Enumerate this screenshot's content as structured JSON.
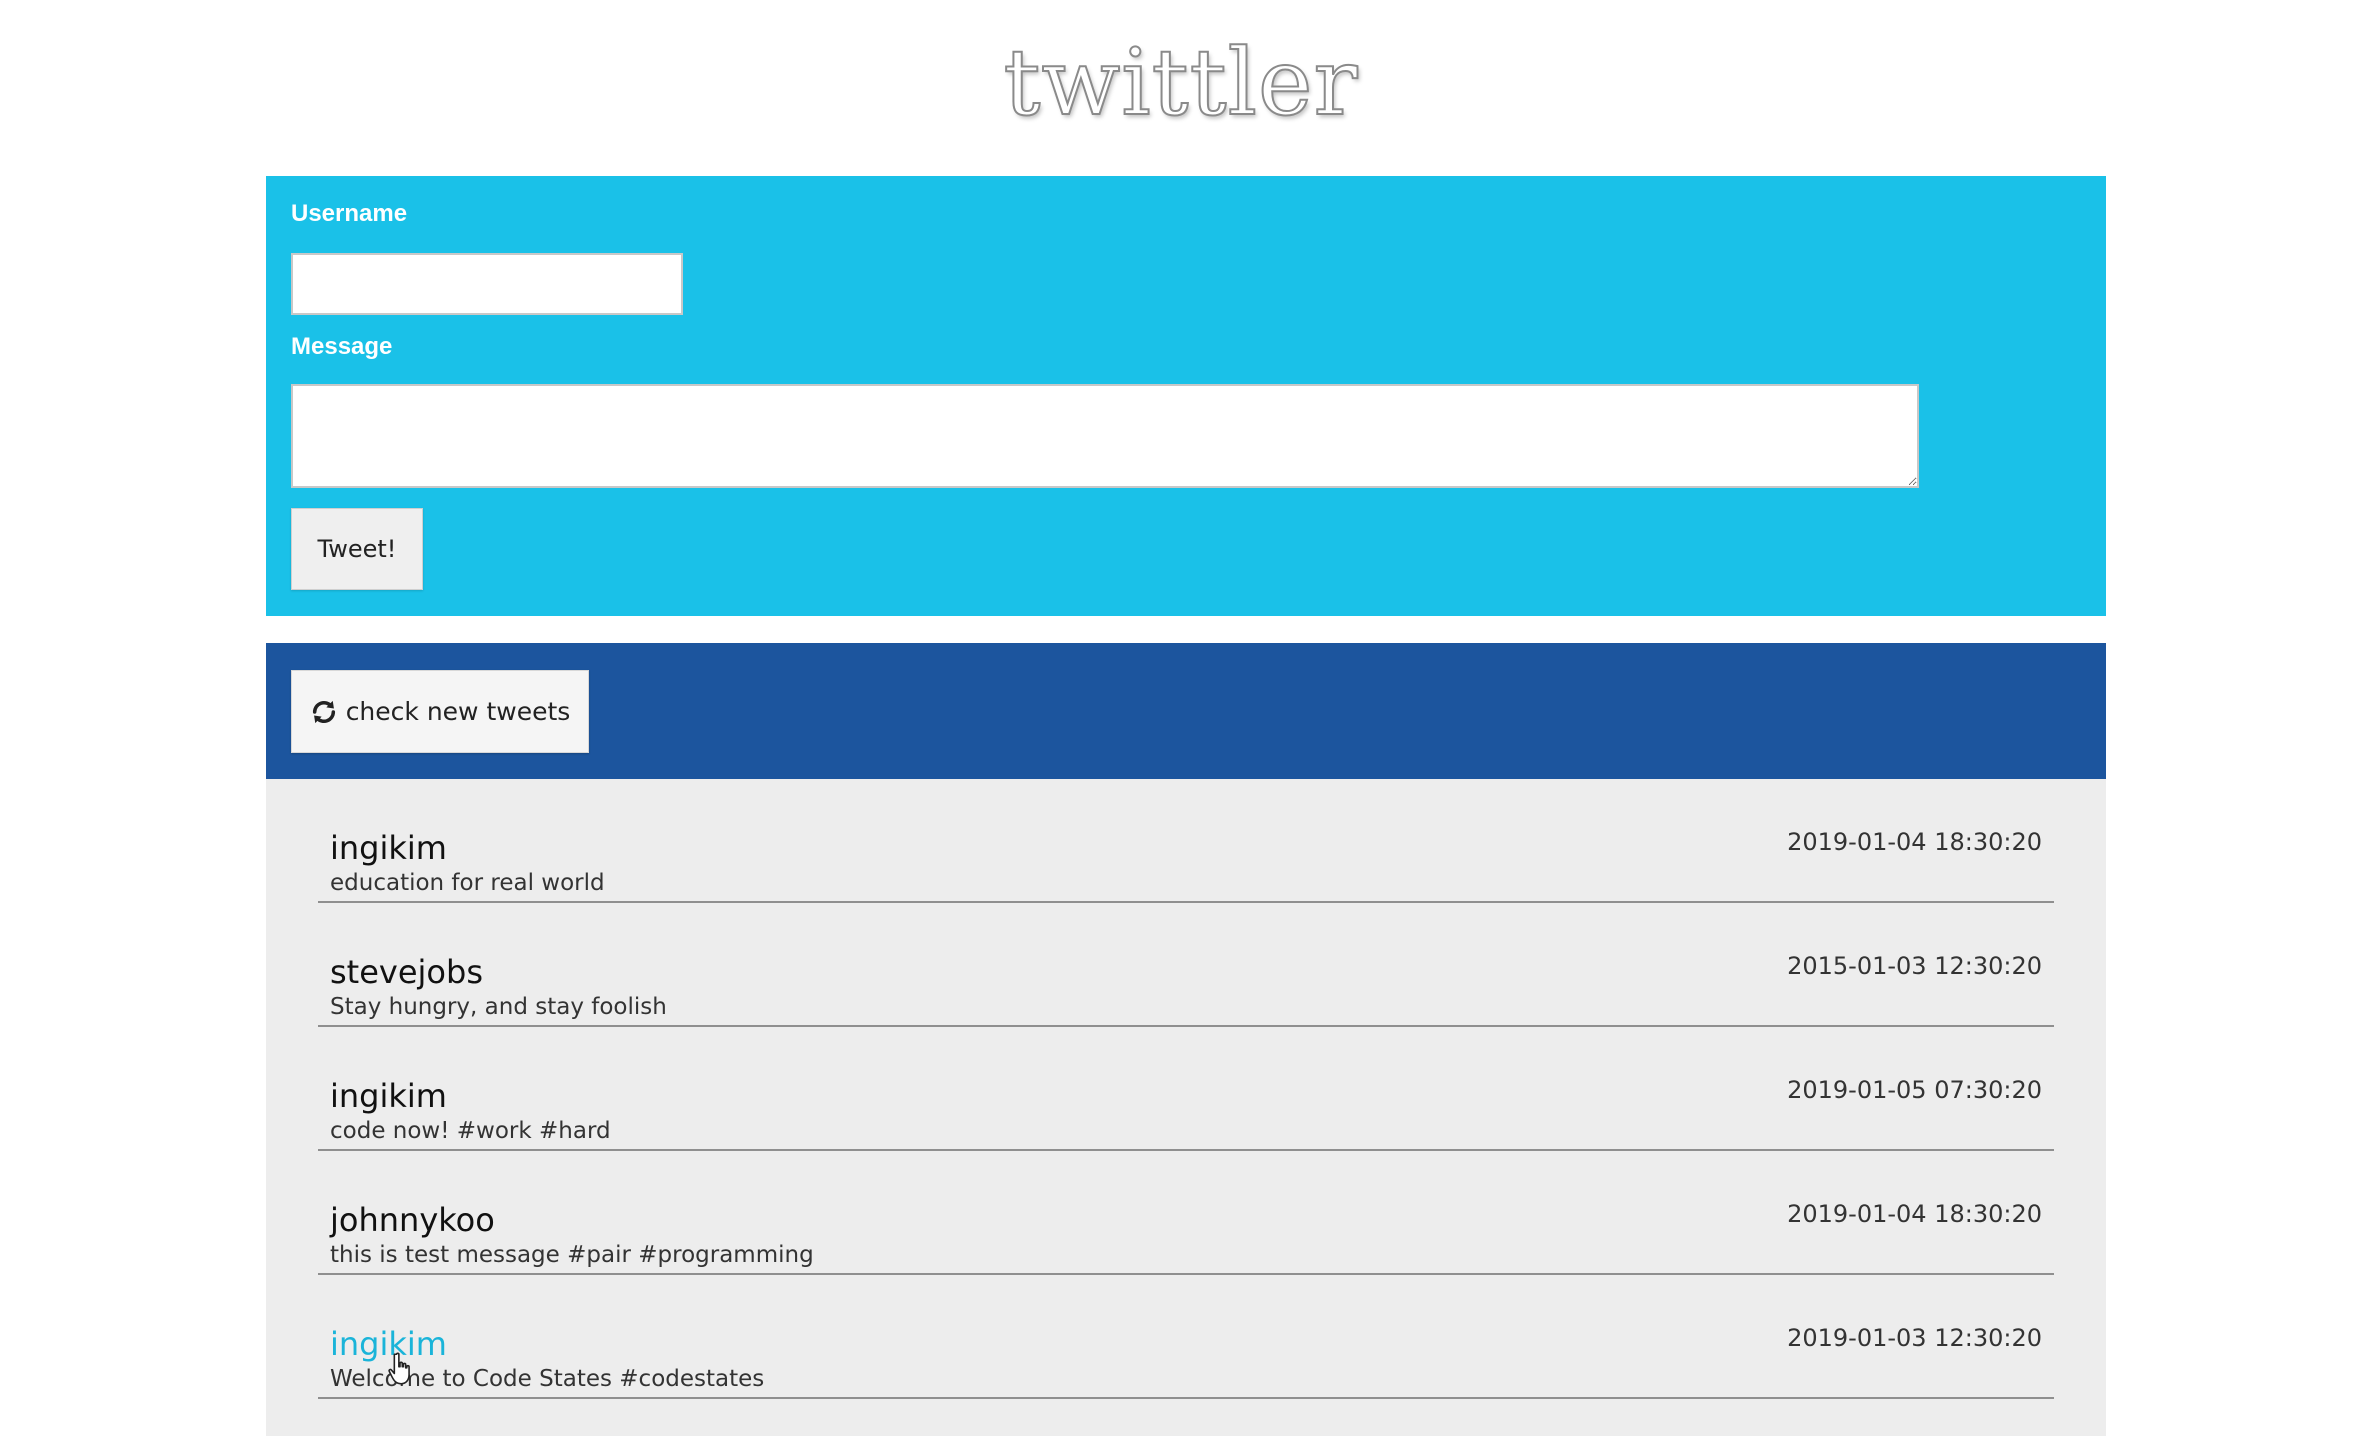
{
  "logo": "twittler",
  "compose": {
    "username_label": "Username",
    "username_value": "",
    "message_label": "Message",
    "message_value": "",
    "tweet_button": "Tweet!"
  },
  "toolbar": {
    "refresh_label": "check new tweets",
    "refresh_icon": "refresh-icon"
  },
  "tweets": [
    {
      "user": "ingikim",
      "message": "education for real world",
      "time": "2019-01-04 18:30:20"
    },
    {
      "user": "stevejobs",
      "message": "Stay hungry, and stay foolish",
      "time": "2015-01-03 12:30:20"
    },
    {
      "user": "ingikim",
      "message": "code now! #work #hard",
      "time": "2019-01-05 07:30:20"
    },
    {
      "user": "johnnykoo",
      "message": "this is test message #pair #programming",
      "time": "2019-01-04 18:30:20"
    },
    {
      "user": "ingikim",
      "message": "Welcome to Code States #codestates",
      "time": "2019-01-03 12:30:20"
    }
  ],
  "colors": {
    "compose_bg": "#1ac1e8",
    "toolbar_bg": "#1c559e",
    "feed_bg": "#ededed",
    "link_hover": "#1ab4d9"
  }
}
